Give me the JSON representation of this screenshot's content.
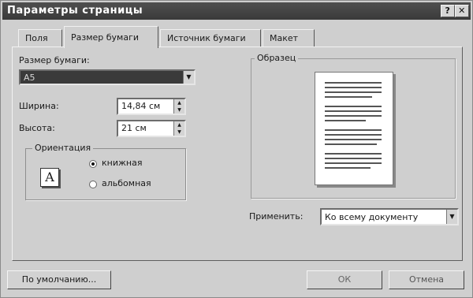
{
  "window": {
    "title": "Параметры страницы",
    "help_label": "?",
    "close_label": "✕"
  },
  "tabs": [
    {
      "label": "Поля"
    },
    {
      "label": "Размер бумаги"
    },
    {
      "label": "Источник бумаги"
    },
    {
      "label": "Макет"
    }
  ],
  "paper_size": {
    "label": "Размер бумаги:",
    "value": "A5"
  },
  "width": {
    "label": "Ширина:",
    "value": "14,84 см"
  },
  "height": {
    "label": "Высота:",
    "value": "21 см"
  },
  "orientation": {
    "title": "Ориентация",
    "icon_letter": "A",
    "portrait_label": "книжная",
    "landscape_label": "альбомная",
    "selected": "portrait"
  },
  "preview": {
    "title": "Образец"
  },
  "apply": {
    "label": "Применить:",
    "value": "Ко всему документу"
  },
  "buttons": {
    "default_label": "По умолчанию...",
    "ok_label": "ОК",
    "cancel_label": "Отмена"
  },
  "icons": {
    "dropdown": "triangle-down",
    "spin_up": "triangle-up",
    "spin_down": "triangle-down"
  }
}
